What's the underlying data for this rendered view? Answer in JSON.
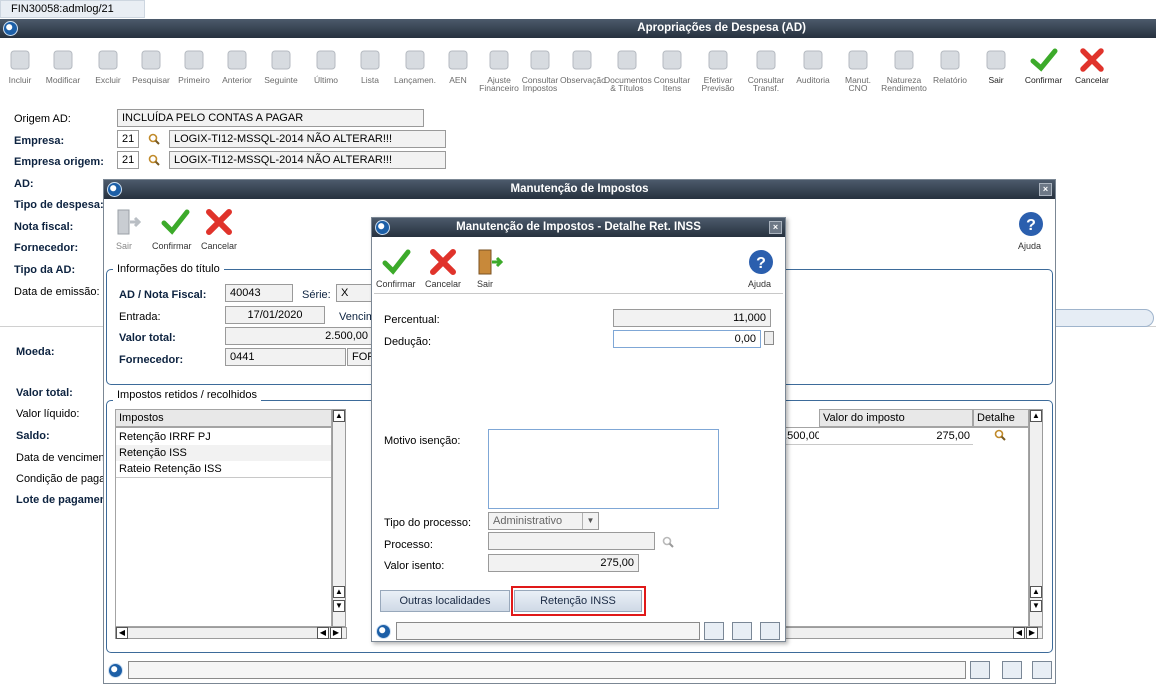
{
  "tab_label": "FIN30058:admlog/21",
  "main_window": {
    "title": "Apropriações de Despesa (AD)"
  },
  "toolbar": [
    {
      "label": "Incluir",
      "icon": "add-icon"
    },
    {
      "label": "Modificar",
      "icon": "edit-icon"
    },
    {
      "label": "Excluir",
      "icon": "trash-icon"
    },
    {
      "label": "Pesquisar",
      "icon": "search-icon"
    },
    {
      "label": "Primeiro",
      "icon": "first-icon"
    },
    {
      "label": "Anterior",
      "icon": "previous-icon"
    },
    {
      "label": "Seguinte",
      "icon": "next-icon"
    },
    {
      "label": "Último",
      "icon": "last-icon"
    },
    {
      "label": "Lista",
      "icon": "list-icon"
    },
    {
      "label": "Lançamen.",
      "icon": "entries-icon"
    },
    {
      "label": "AEN",
      "icon": "aen-icon"
    },
    {
      "label": "Ajuste\nFinanceiro",
      "icon": "adjust-icon"
    },
    {
      "label": "Consultar\nImpostos",
      "icon": "taxes-icon"
    },
    {
      "label": "Observação",
      "icon": "note-icon"
    },
    {
      "label": "Documentos\n& Títulos",
      "icon": "documents-icon"
    },
    {
      "label": "Consultar\nItens",
      "icon": "items-icon"
    },
    {
      "label": "Efetivar\nPrevisão",
      "icon": "forecast-icon"
    },
    {
      "label": "Consultar\nTransf.",
      "icon": "transfer-icon"
    },
    {
      "label": "Auditoria",
      "icon": "audit-icon"
    },
    {
      "label": "Manut.\nCNO",
      "icon": "cno-icon"
    },
    {
      "label": "Natureza\nRendimento",
      "icon": "nature-icon"
    },
    {
      "label": "Relatório",
      "icon": "printer-icon"
    },
    {
      "label": "Sair",
      "icon": "exit-icon"
    },
    {
      "label": "Confirmar",
      "icon": "check-icon"
    },
    {
      "label": "Cancelar",
      "icon": "cancel-icon"
    }
  ],
  "main_form": {
    "origem_label": "Origem AD:",
    "origem_value": "INCLUÍDA PELO CONTAS A PAGAR",
    "empresa_label": "Empresa:",
    "empresa_code": "21",
    "empresa_name": "LOGIX-TI12-MSSQL-2014 NÃO ALTERAR!!!",
    "empresa_origem_label": "Empresa origem:",
    "empresa_origem_code": "21",
    "empresa_origem_name": "LOGIX-TI12-MSSQL-2014 NÃO ALTERAR!!!",
    "ad_label": "AD:",
    "tipo_despesa_label": "Tipo de despesa:",
    "nota_fiscal_label": "Nota fiscal:",
    "fornecedor_label": "Fornecedor:",
    "tipo_ad_label": "Tipo da AD:",
    "data_emissao_label": "Data de emissão:",
    "moeda_label": "Moeda:",
    "valor_total_label": "Valor total:",
    "valor_liquido_label": "Valor líquido:",
    "saldo_label": "Saldo:",
    "data_vencimento_label": "Data de vencimento",
    "condicao_label": "Condição de pagam",
    "lote_label": "Lote de pagamento"
  },
  "impostos_window": {
    "title": "Manutenção de Impostos",
    "sair": "Sair",
    "confirmar": "Confirmar",
    "cancelar": "Cancelar",
    "ajuda": "Ajuda",
    "info_group": "Informações do título",
    "ad_nota_label": "AD / Nota Fiscal:",
    "ad_nota_value": "40043",
    "serie_label": "Série:",
    "serie_value": "X",
    "entrada_label": "Entrada:",
    "entrada_value": "17/01/2020",
    "venc_label": "Vencim",
    "valor_total_label": "Valor total:",
    "valor_total_value": "2.500,00",
    "fornecedor_label": "Fornecedor:",
    "fornecedor_value": "0441",
    "fornecedor_extra": "FOR",
    "retidos_group": "Impostos retidos / recolhidos",
    "grid_header": "Impostos",
    "rows": [
      "Retenção IRRF PJ",
      "Retenção ISS",
      "Rateio Retenção ISS"
    ],
    "right_grid_headers": [
      "Valor do imposto",
      "Detalhe"
    ],
    "right_row_base": "2.500,00",
    "right_row_value": "275,00"
  },
  "detalhe_window": {
    "title": "Manutenção de Impostos - Detalhe Ret. INSS",
    "confirmar": "Confirmar",
    "cancelar": "Cancelar",
    "sair": "Sair",
    "ajuda": "Ajuda",
    "percentual_label": "Percentual:",
    "percentual_value": "11,000",
    "deducao_label": "Dedução:",
    "deducao_value": "0,00",
    "motivo_label": "Motivo isenção:",
    "motivo_value": "",
    "tipo_processo_label": "Tipo do processo:",
    "tipo_processo_value": "Administrativo",
    "processo_label": "Processo:",
    "processo_value": "",
    "valor_isento_label": "Valor isento:",
    "valor_isento_value": "275,00",
    "btn_outras": "Outras localidades",
    "btn_retencao": "Retenção INSS"
  },
  "colors": {
    "titlebar": "#26313e",
    "group_border": "#3d6b9a",
    "highlight": "#e01919"
  }
}
